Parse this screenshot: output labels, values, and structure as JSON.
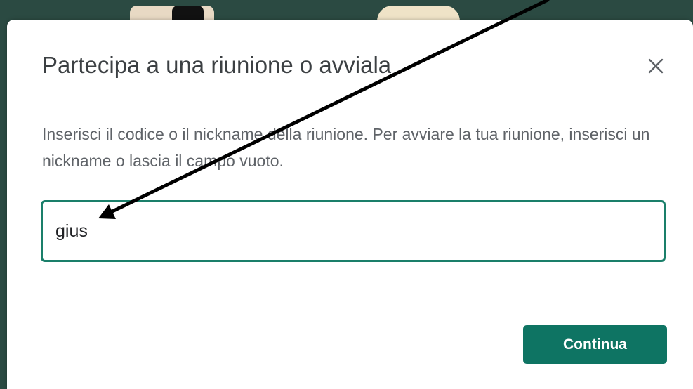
{
  "dialog": {
    "title": "Partecipa a una riunione o avviala",
    "description": "Inserisci il codice o il nickname della riunione. Per avviare la tua riunione, inserisci un nickname o lascia il campo vuoto.",
    "input_value": "gius",
    "continue_label": "Continua",
    "close_icon": "close-icon"
  },
  "colors": {
    "accent": "#0e7463",
    "input_border": "#1a7f6a",
    "backdrop": "#2b4a42",
    "title_text": "#3c4043",
    "body_text": "#5f6368"
  }
}
